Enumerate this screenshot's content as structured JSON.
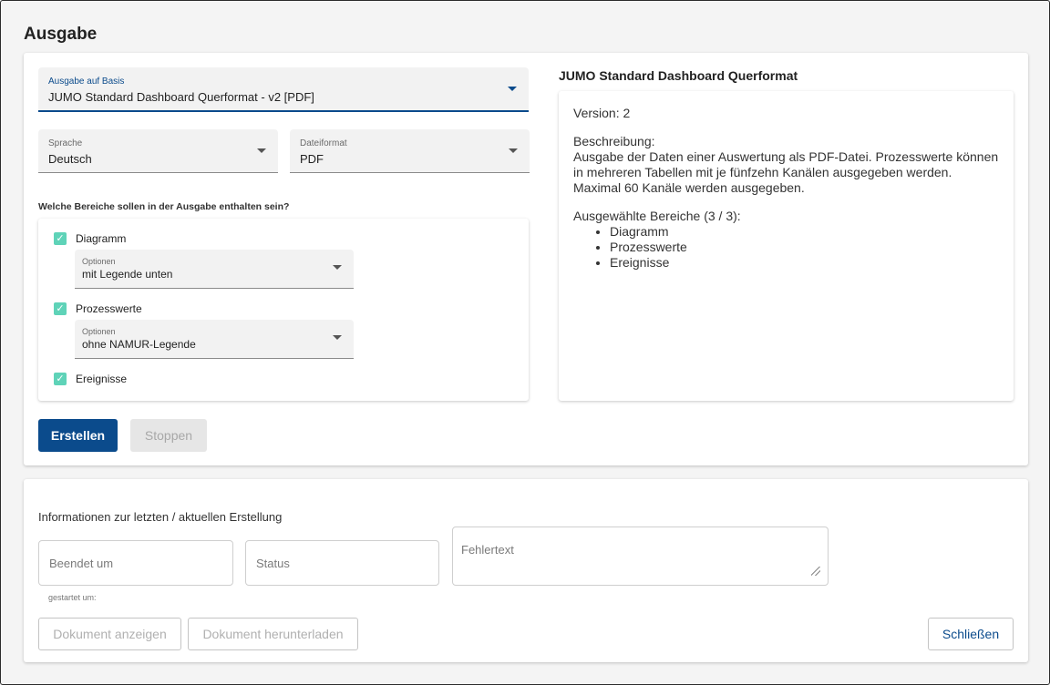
{
  "dialog": {
    "title": "Ausgabe"
  },
  "config": {
    "basis": {
      "label": "Ausgabe auf Basis",
      "value": "JUMO Standard Dashboard Querformat - v2 [PDF]"
    },
    "sprache": {
      "label": "Sprache",
      "value": "Deutsch"
    },
    "dateiformat": {
      "label": "Dateiformat",
      "value": "PDF"
    },
    "areas_question": "Welche Bereiche sollen in der Ausgabe enthalten sein?",
    "areas": [
      {
        "label": "Diagramm",
        "checked": true,
        "options_label": "Optionen",
        "options_value": "mit Legende unten"
      },
      {
        "label": "Prozesswerte",
        "checked": true,
        "options_label": "Optionen",
        "options_value": "ohne NAMUR-Legende"
      },
      {
        "label": "Ereignisse",
        "checked": true
      }
    ],
    "buttons": {
      "create": "Erstellen",
      "stop": "Stoppen"
    }
  },
  "info": {
    "title": "JUMO Standard Dashboard Querformat",
    "version": "Version: 2",
    "description_label": "Beschreibung:",
    "description": "Ausgabe der Daten einer Auswertung als PDF-Datei. Prozesswerte können in mehreren Tabellen mit je fünfzehn Kanälen ausgegeben werden. Maximal 60 Kanäle werden ausgegeben.",
    "selected_label": "Ausgewählte Bereiche (3 / 3):",
    "selected": [
      "Diagramm",
      "Prozesswerte",
      "Ereignisse"
    ]
  },
  "status": {
    "title": "Informationen zur letzten / aktuellen Erstellung",
    "finished_placeholder": "Beendet um",
    "status_placeholder": "Status",
    "error_placeholder": "Fehlertext",
    "started_hint": "gestartet um:",
    "buttons": {
      "show": "Dokument anzeigen",
      "download": "Dokument herunterladen",
      "close": "Schließen"
    }
  },
  "colors": {
    "primary": "#0b4b8c",
    "checkbox": "#5fd3b8"
  },
  "icons": {
    "dropdown": "chevron-down-icon",
    "checkbox": "check-icon"
  }
}
